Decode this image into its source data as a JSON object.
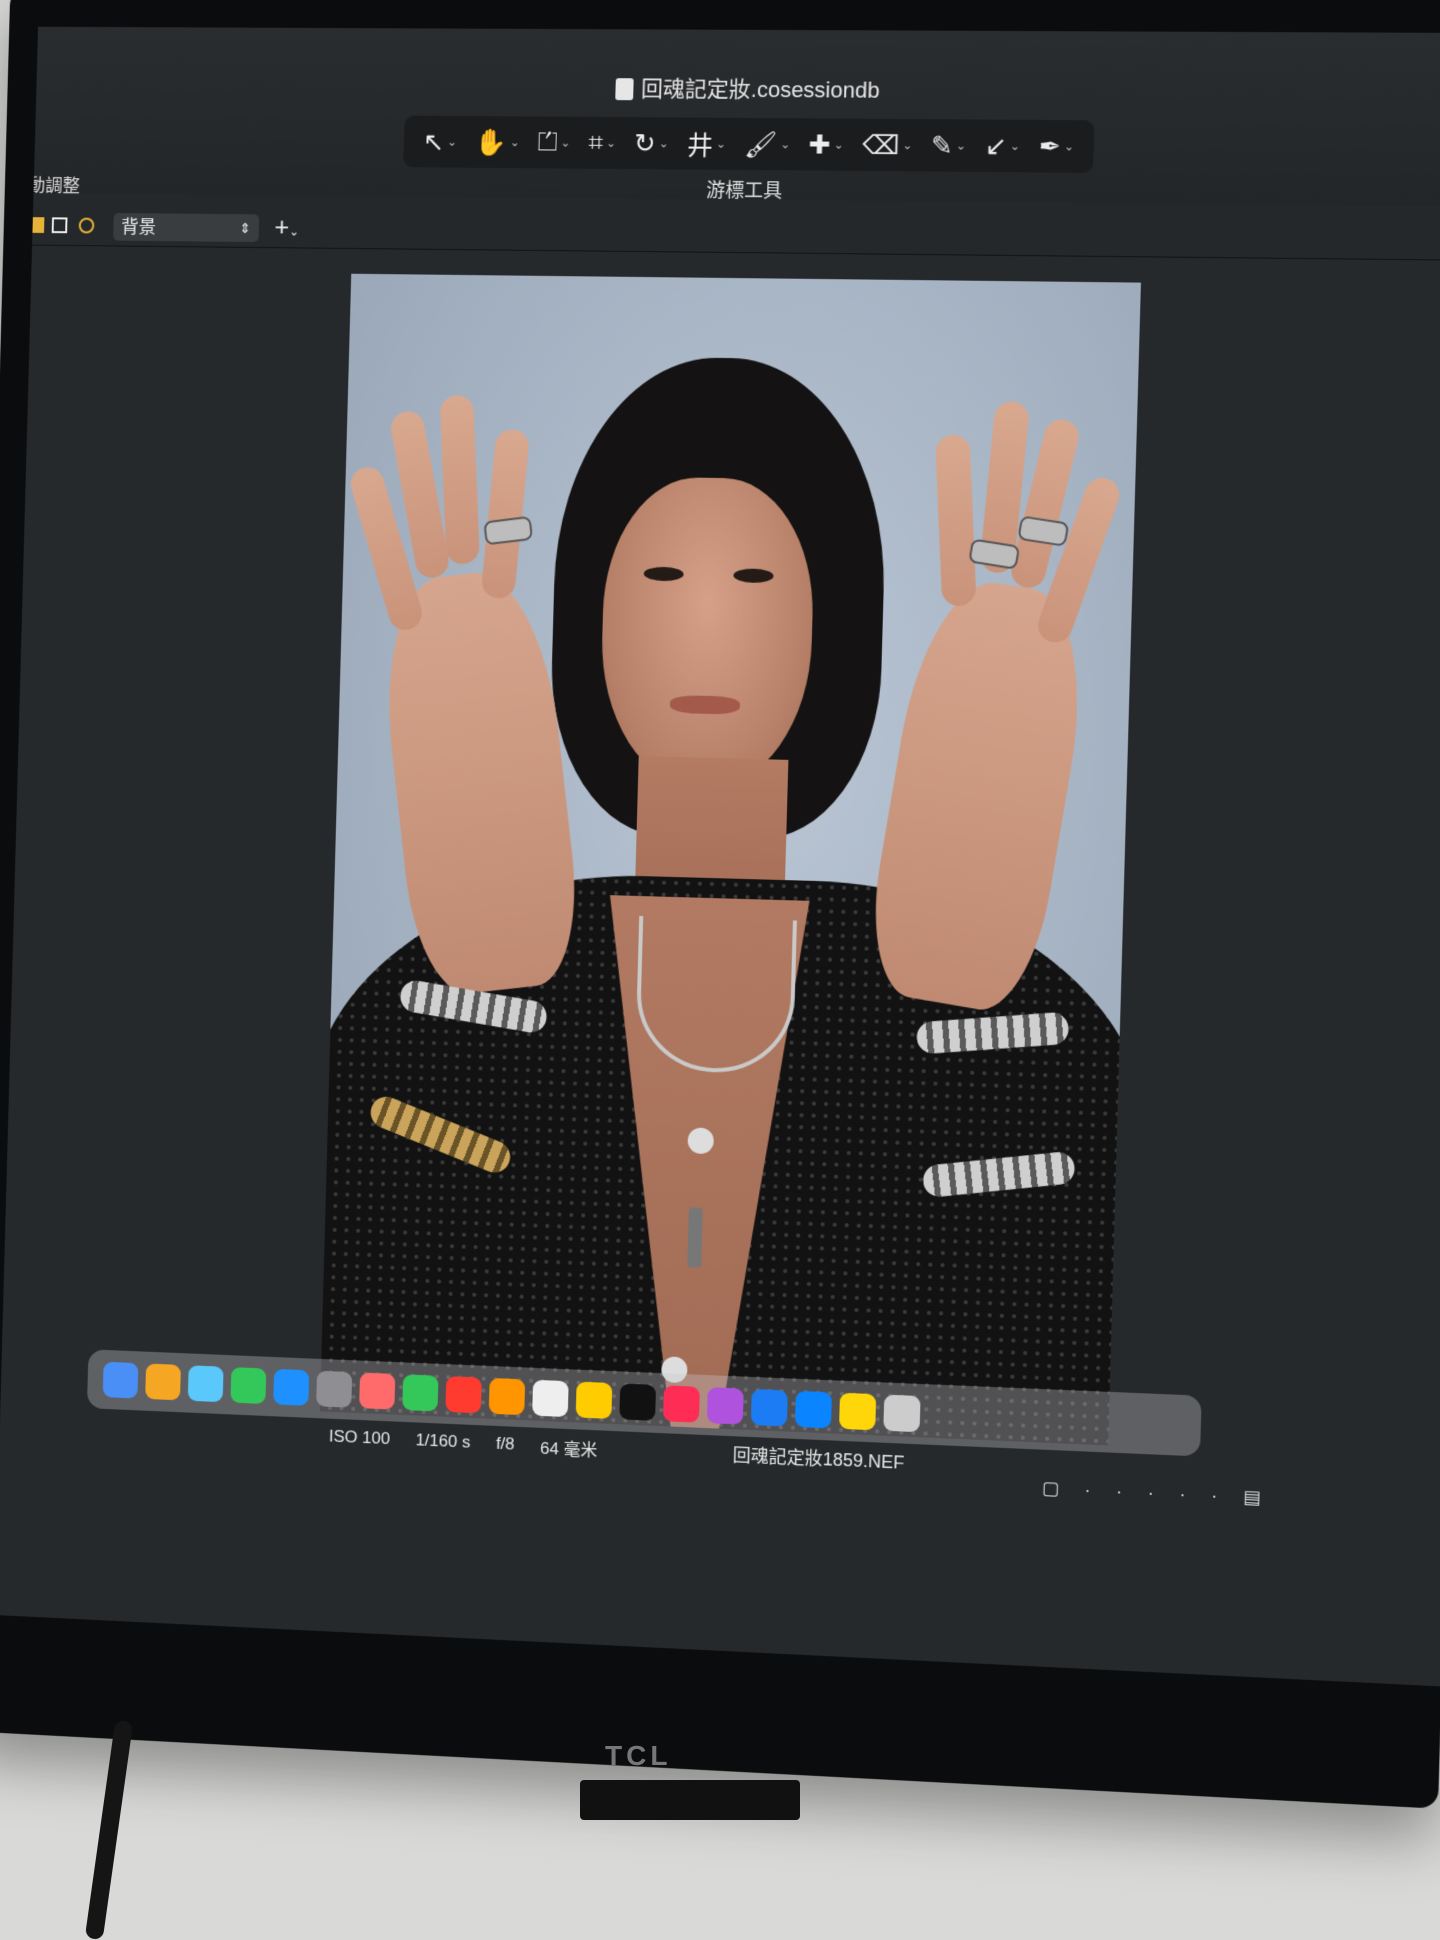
{
  "window": {
    "document_title": "回魂記定妝.cosessiondb",
    "tool_caption": "游標工具",
    "side_label": "動調整"
  },
  "toolbar": {
    "tools": [
      {
        "icon": "cursor-arrow-icon",
        "glyph": "↖"
      },
      {
        "icon": "hand-pan-icon",
        "glyph": "✋"
      },
      {
        "icon": "straighten-icon",
        "glyph": "⏍"
      },
      {
        "icon": "crop-icon",
        "glyph": "⌗"
      },
      {
        "icon": "rotate-icon",
        "glyph": "↻"
      },
      {
        "icon": "keystone-icon",
        "glyph": "井"
      },
      {
        "icon": "brush-icon",
        "glyph": "🖌"
      },
      {
        "icon": "healing-icon",
        "glyph": "✚"
      },
      {
        "icon": "eraser-icon",
        "glyph": "⌫"
      },
      {
        "icon": "eyedropper-icon",
        "glyph": "✎"
      },
      {
        "icon": "arrow-tool-icon",
        "glyph": "↙"
      },
      {
        "icon": "pen-icon",
        "glyph": "✒"
      }
    ]
  },
  "layers": {
    "selected_layer": "背景"
  },
  "photo_meta": {
    "iso": "ISO 100",
    "shutter": "1/160 s",
    "aperture": "f/8",
    "focal_length": "64 毫米",
    "filename": "回魂記定妝1859.NEF"
  },
  "dock": {
    "apps": [
      "#4a8ff5",
      "#f5a623",
      "#5ac8fa",
      "#34c759",
      "#1e90ff",
      "#8e8e93",
      "#ff6b6b",
      "#34c759",
      "#ff3b30",
      "#ff9500",
      "#eeeeee",
      "#ffcc00",
      "#111111",
      "#ff2d55",
      "#af52de",
      "#1c7cf4",
      "#0a84ff",
      "#ffd60a",
      "#cccccc"
    ]
  },
  "monitor": {
    "brand": "TCL"
  }
}
